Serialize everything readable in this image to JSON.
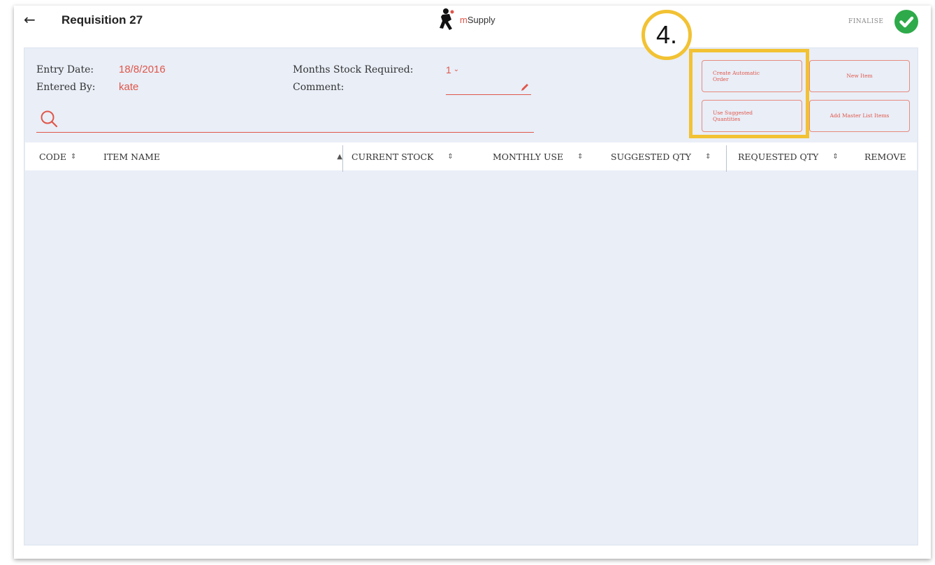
{
  "header": {
    "back_icon": "arrow-left-icon",
    "title": "Requisition 27",
    "logo_m": "m",
    "logo_rest": "Supply",
    "finalise_label": "FINALISE",
    "finalise_icon": "check-circle-icon",
    "finalise_color": "#2eaa4a"
  },
  "info": {
    "entry_date_label": "Entry Date:",
    "entry_date_value": "18/8/2016",
    "entered_by_label": "Entered By:",
    "entered_by_value": "kate",
    "months_label": "Months Stock Required:",
    "months_value": "1",
    "comment_label": "Comment:",
    "comment_value": ""
  },
  "search": {
    "icon": "search-icon",
    "placeholder": ""
  },
  "buttons": {
    "create_automatic_order": "Create Automatic Order",
    "new_item": "New Item",
    "use_suggested_quantities": "Use Suggested Quantities",
    "add_master_list_items": "Add Master List Items"
  },
  "tutorial": {
    "step": "4."
  },
  "table": {
    "columns": [
      {
        "label": "CODE",
        "sort": "unsorted"
      },
      {
        "label": "ITEM NAME",
        "sort": "ascending"
      },
      {
        "label": "CURRENT STOCK",
        "sort": "unsorted"
      },
      {
        "label": "MONTHLY USE",
        "sort": "unsorted"
      },
      {
        "label": "SUGGESTED QTY",
        "sort": "unsorted"
      },
      {
        "label": "REQUESTED QTY",
        "sort": "unsorted"
      },
      {
        "label": "REMOVE"
      }
    ],
    "rows": []
  },
  "colors": {
    "accent": "#e0564a",
    "panel_bg": "#e9eef7",
    "highlight": "#f2c233"
  }
}
